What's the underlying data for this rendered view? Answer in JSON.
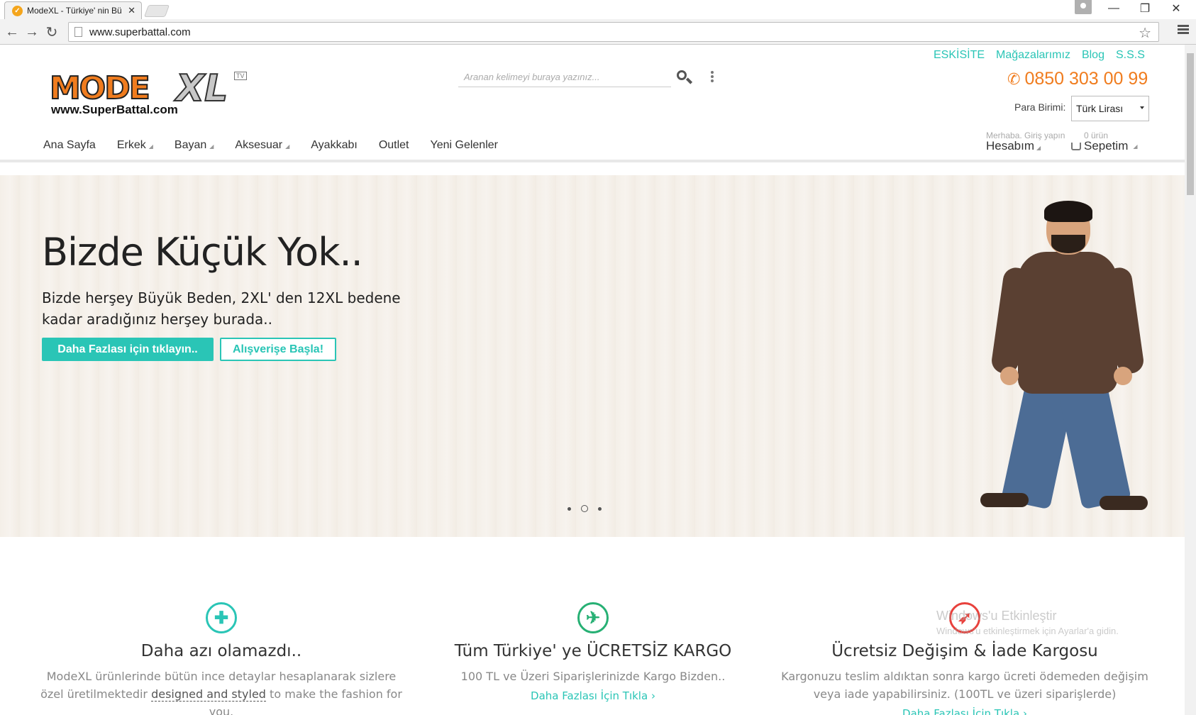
{
  "browser": {
    "tab_title": "ModeXL - Türkiye' nin Bü",
    "url": "www.superbattal.com"
  },
  "header": {
    "logo": {
      "main": "MODE",
      "xl": "XL",
      "site": "www.SuperBattal.com",
      "tv": "TV"
    },
    "search_placeholder": "Aranan kelimeyi buraya yazınız...",
    "top_links": [
      "ESKİSİTE",
      "Mağazalarımız",
      "Blog",
      "S.S.S"
    ],
    "phone": "0850 303 00 99",
    "currency_label": "Para Birimi:",
    "currency_value": "Türk Lirası"
  },
  "nav": {
    "items": [
      "Ana Sayfa",
      "Erkek",
      "Bayan",
      "Aksesuar",
      "Ayakkabı",
      "Outlet",
      "Yeni Gelenler"
    ],
    "account_small": "Merhaba. Giriş yapın",
    "account_label": "Hesabım",
    "cart_small": "0 ürün",
    "cart_label": "Sepetim"
  },
  "hero": {
    "title": "Bizde Küçük Yok..",
    "subtitle": "Bizde herşey Büyük Beden, 2XL' den 12XL bedene kadar aradığınız herşey burada..",
    "btn_more": "Daha Fazlası için tıklayın..",
    "btn_shop": "Alışverişe Başla!"
  },
  "features": [
    {
      "icon": "puzzle-icon",
      "color": "#2ac5b6",
      "title": "Daha azı olamazdı..",
      "text_before": "ModeXL ürünlerinde bütün ince detaylar hesaplanarak sizlere özel üretilmektedir ",
      "text_link": "designed and styled",
      "text_after": " to make the fashion for you."
    },
    {
      "icon": "plane-icon",
      "color": "#27b074",
      "title": "Tüm Türkiye' ye ÜCRETSİZ KARGO",
      "text": "100 TL ve Üzeri Siparişlerinizde Kargo Bizden..",
      "more": "Daha Fazlası İçin Tıkla ›"
    },
    {
      "icon": "rocket-icon",
      "color": "#e8413c",
      "title": "Ücretsiz Değişim & İade Kargosu",
      "text": "Kargonuzu teslim aldıktan sonra kargo ücreti ödemeden değişim veya iade yapabilirsiniz. (100TL ve üzeri siparişlerde)",
      "more": "Daha Fazlası İçin Tıkla ›"
    }
  ],
  "watermark": {
    "line1": "Windows'u Etkinleştir",
    "line2": "Windows'u etkinleştirmek için Ayarlar'a gidin."
  }
}
